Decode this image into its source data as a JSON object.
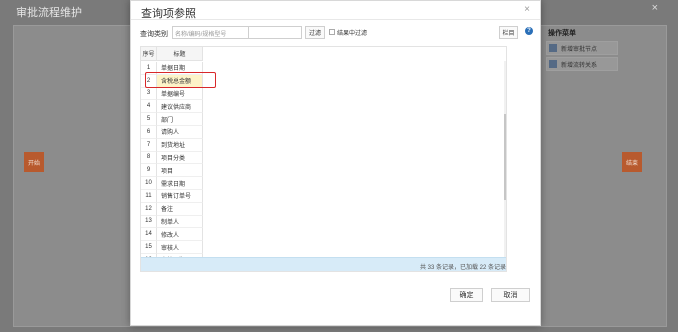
{
  "background": {
    "title": "审批流程维护",
    "close": "×",
    "start_btn": "开始",
    "end_btn": "结束",
    "menu": {
      "title": "操作菜单",
      "items": [
        {
          "label": "新增审批节点",
          "icon": "node-icon"
        },
        {
          "label": "新增流转关系",
          "icon": "relation-icon"
        }
      ]
    }
  },
  "dialog": {
    "title": "查询项参照",
    "close": "×",
    "toolbar": {
      "type_label": "查询类别",
      "type_value": "名称/编码/规格型号",
      "filter_value": "",
      "filter_btn": "过滤",
      "checkbox_label": "结果中过滤",
      "column_btn": "栏目",
      "help": "?"
    },
    "grid": {
      "headers": [
        "序号",
        "标题"
      ],
      "rows": [
        {
          "num": "1",
          "title": "单据日期"
        },
        {
          "num": "2",
          "title": "含税总金额"
        },
        {
          "num": "3",
          "title": "单据编号"
        },
        {
          "num": "4",
          "title": "建议供应商"
        },
        {
          "num": "5",
          "title": "部门"
        },
        {
          "num": "6",
          "title": "请购人"
        },
        {
          "num": "7",
          "title": "到货地址"
        },
        {
          "num": "8",
          "title": "项目分类"
        },
        {
          "num": "9",
          "title": "项目"
        },
        {
          "num": "10",
          "title": "需求日期"
        },
        {
          "num": "11",
          "title": "销售订单号"
        },
        {
          "num": "12",
          "title": "备注"
        },
        {
          "num": "13",
          "title": "制单人"
        },
        {
          "num": "14",
          "title": "修改人"
        },
        {
          "num": "15",
          "title": "审核人"
        },
        {
          "num": "16",
          "title": "审核日期"
        },
        {
          "num": "17",
          "title": "打印次数"
        }
      ],
      "selected_row": 1,
      "footer": "共 33 条记录，已加载 22 条记录"
    },
    "ok_btn": "确定",
    "cancel_btn": "取消"
  }
}
